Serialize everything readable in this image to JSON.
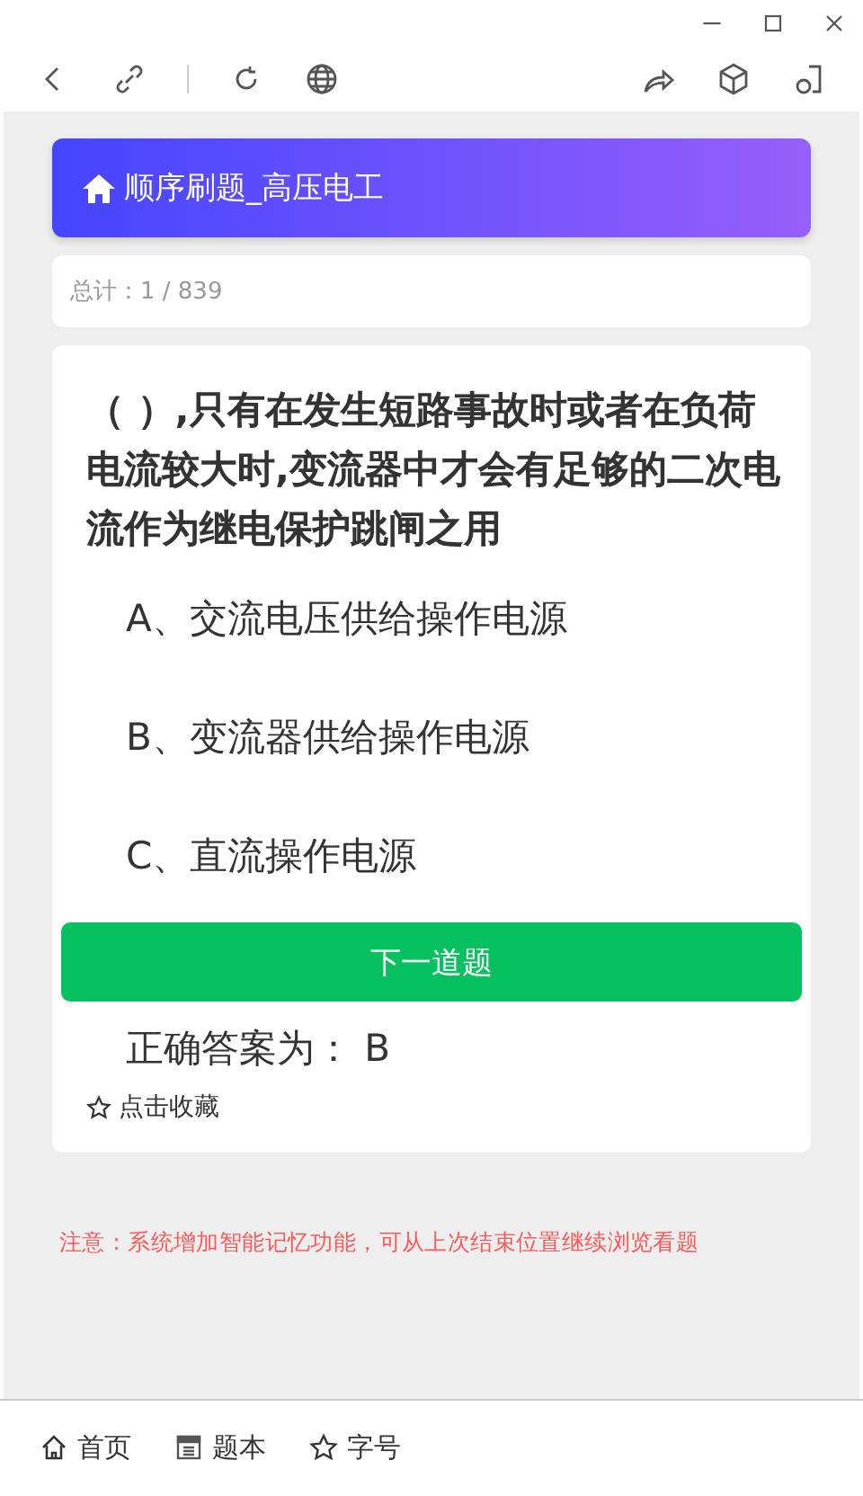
{
  "header": {
    "title": "顺序刷题_高压电工"
  },
  "counter": {
    "label": "总计：",
    "value": "1 / 839"
  },
  "question": {
    "text": "（ ）,只有在发生短路事故时或者在负荷电流较大时,变流器中才会有足够的二次电流作为继电保护跳闸之用",
    "options": [
      "A、交流电压供给操作电源",
      "B、变流器供给操作电源",
      "C、直流操作电源"
    ],
    "next_button": "下一道题",
    "answer": "正确答案为：  B",
    "favorite": "点击收藏"
  },
  "notice": "注意：系统增加智能记忆功能，可从上次结束位置继续浏览看题",
  "bottom_nav": [
    {
      "kind": "home",
      "label": "首页"
    },
    {
      "kind": "book",
      "label": "题本"
    },
    {
      "kind": "star",
      "label": "字号"
    }
  ]
}
